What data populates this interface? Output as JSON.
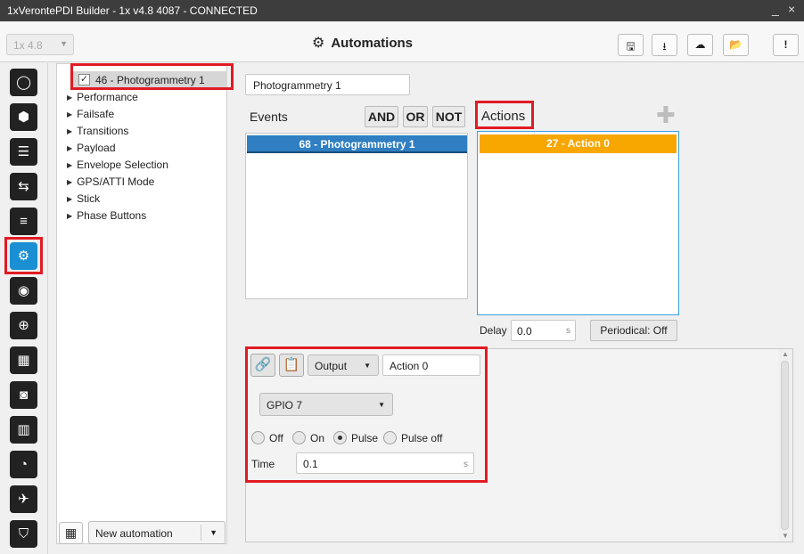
{
  "window": {
    "title": "1xVerontePDI Builder - 1x v4.8 4087 - CONNECTED",
    "controls": [
      "_",
      "×"
    ]
  },
  "toolbar": {
    "version_select": "1x 4.8",
    "page_title": "Automations",
    "buttons": [
      {
        "name": "save",
        "icon": "save-icon",
        "glyph": "🖫"
      },
      {
        "name": "download",
        "icon": "download-icon",
        "glyph": "⭳"
      },
      {
        "name": "cloud",
        "icon": "cloud-download-icon",
        "glyph": "☁"
      },
      {
        "name": "open",
        "icon": "folder-open-icon",
        "glyph": "📂"
      },
      {
        "name": "info",
        "icon": "info-icon",
        "glyph": "!"
      }
    ]
  },
  "sidebar": {
    "items": [
      {
        "icon": "power-icon",
        "glyph": "◯"
      },
      {
        "icon": "globe-icon",
        "glyph": "⬢"
      },
      {
        "icon": "rss-icon",
        "glyph": "☰"
      },
      {
        "icon": "usb-icon",
        "glyph": "⇆"
      },
      {
        "icon": "sliders-icon",
        "glyph": "≡"
      },
      {
        "icon": "gears-icon",
        "glyph": "⚙",
        "active": true
      },
      {
        "icon": "broadcast-icon",
        "glyph": "◉"
      },
      {
        "icon": "gamepad-icon",
        "glyph": "⊕"
      },
      {
        "icon": "grid-icon",
        "glyph": "▦"
      },
      {
        "icon": "camera-icon",
        "glyph": "◙"
      },
      {
        "icon": "chart-icon",
        "glyph": "▥"
      },
      {
        "icon": "gauge-icon",
        "glyph": "◔"
      },
      {
        "icon": "plane-icon",
        "glyph": "✈"
      },
      {
        "icon": "shield-icon",
        "glyph": "⛉"
      }
    ]
  },
  "tree": {
    "selected": {
      "label": "46 - Photogrammetry 1",
      "checked": true
    },
    "items": [
      "Performance",
      "Failsafe",
      "Transitions",
      "Payload",
      "Envelope Selection",
      "GPS/ATTI Mode",
      "Stick",
      "Phase Buttons"
    ],
    "new_automation": "New automation"
  },
  "automation": {
    "name": "Photogrammetry 1",
    "events_label": "Events",
    "actions_label": "Actions",
    "logic": [
      "AND",
      "OR",
      "NOT"
    ],
    "events": [
      "68 - Photogrammetry 1"
    ],
    "actions": [
      "27 - Action 0"
    ],
    "delay_label": "Delay",
    "delay_value": "0.0",
    "delay_unit": "s",
    "periodical": "Periodical: Off"
  },
  "action_config": {
    "type": "Output",
    "name": "Action 0",
    "output": "GPIO 7",
    "modes": [
      {
        "label": "Off",
        "selected": false
      },
      {
        "label": "On",
        "selected": false
      },
      {
        "label": "Pulse",
        "selected": true
      },
      {
        "label": "Pulse off",
        "selected": false
      }
    ],
    "time_label": "Time",
    "time_value": "0.1",
    "time_unit": "s"
  },
  "colors": {
    "highlight": "#e11b24",
    "event_item": "#2f7fc2",
    "action_item": "#f8a600",
    "active_nav": "#1a8fd3"
  }
}
